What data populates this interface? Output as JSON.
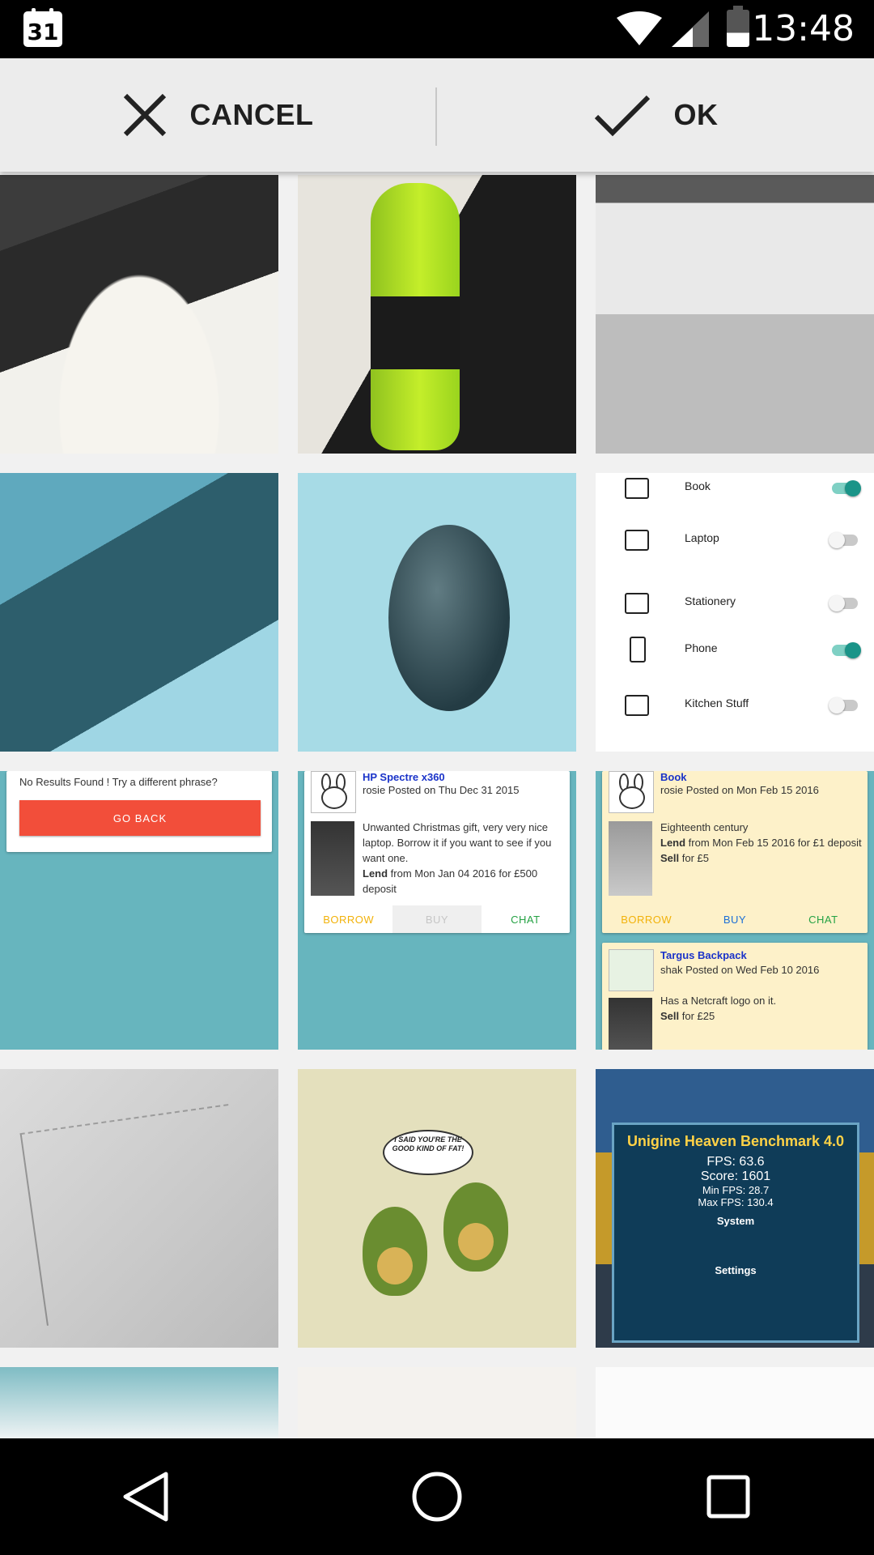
{
  "status_bar": {
    "calendar_day": "31",
    "time": "13:48"
  },
  "action_bar": {
    "cancel_label": "CANCEL",
    "ok_label": "OK"
  },
  "tiles": {
    "settings_list": [
      {
        "label": "Book",
        "on": true
      },
      {
        "label": "Laptop",
        "on": false
      },
      {
        "label": "Stationery",
        "on": false
      },
      {
        "label": "Phone",
        "on": true
      },
      {
        "label": "Kitchen Stuff",
        "on": false
      }
    ],
    "no_results": {
      "message": "No Results Found ! Try a different phrase?",
      "button": "GO BACK"
    },
    "listing_a": {
      "title": "HP Spectre x360",
      "posted": "rosie Posted on Thu Dec 31 2015",
      "desc1": "Unwanted Christmas gift, very very nice laptop. Borrow it if you want to see if you want one.",
      "lend_label": "Lend",
      "lend_text": " from Mon Jan 04 2016 for £500 deposit",
      "borrow": "BORROW",
      "buy": "BUY",
      "chat": "CHAT"
    },
    "listing_b": {
      "title": "Book",
      "posted": "rosie Posted on Mon Feb 15 2016",
      "desc1": "Eighteenth century",
      "lend_label": "Lend",
      "lend_text": " from Mon Feb 15 2016 for £1 deposit",
      "sell_label": "Sell",
      "sell_text": " for £5",
      "borrow": "BORROW",
      "buy": "BUY",
      "chat": "CHAT"
    },
    "listing_c": {
      "title": "Targus Backpack",
      "posted": "shak Posted on Wed Feb 10 2016",
      "desc1": "Has a Netcraft logo on it.",
      "sell_label": "Sell",
      "sell_text": " for £25"
    },
    "avocado_caption": "I SAID YOU'RE THE GOOD KIND OF FAT!",
    "benchmark": {
      "title": "Unigine Heaven Benchmark 4.0",
      "fps": "FPS: 63.6",
      "score": "Score: 1601",
      "min_fps": "Min FPS: 28.7",
      "max_fps": "Max FPS: 130.4",
      "system": "System",
      "settings": "Settings"
    }
  },
  "colors": {
    "accent_teal": "#1a9488",
    "go_back_red": "#f24e3a",
    "cream_card": "#fdf1c9"
  }
}
